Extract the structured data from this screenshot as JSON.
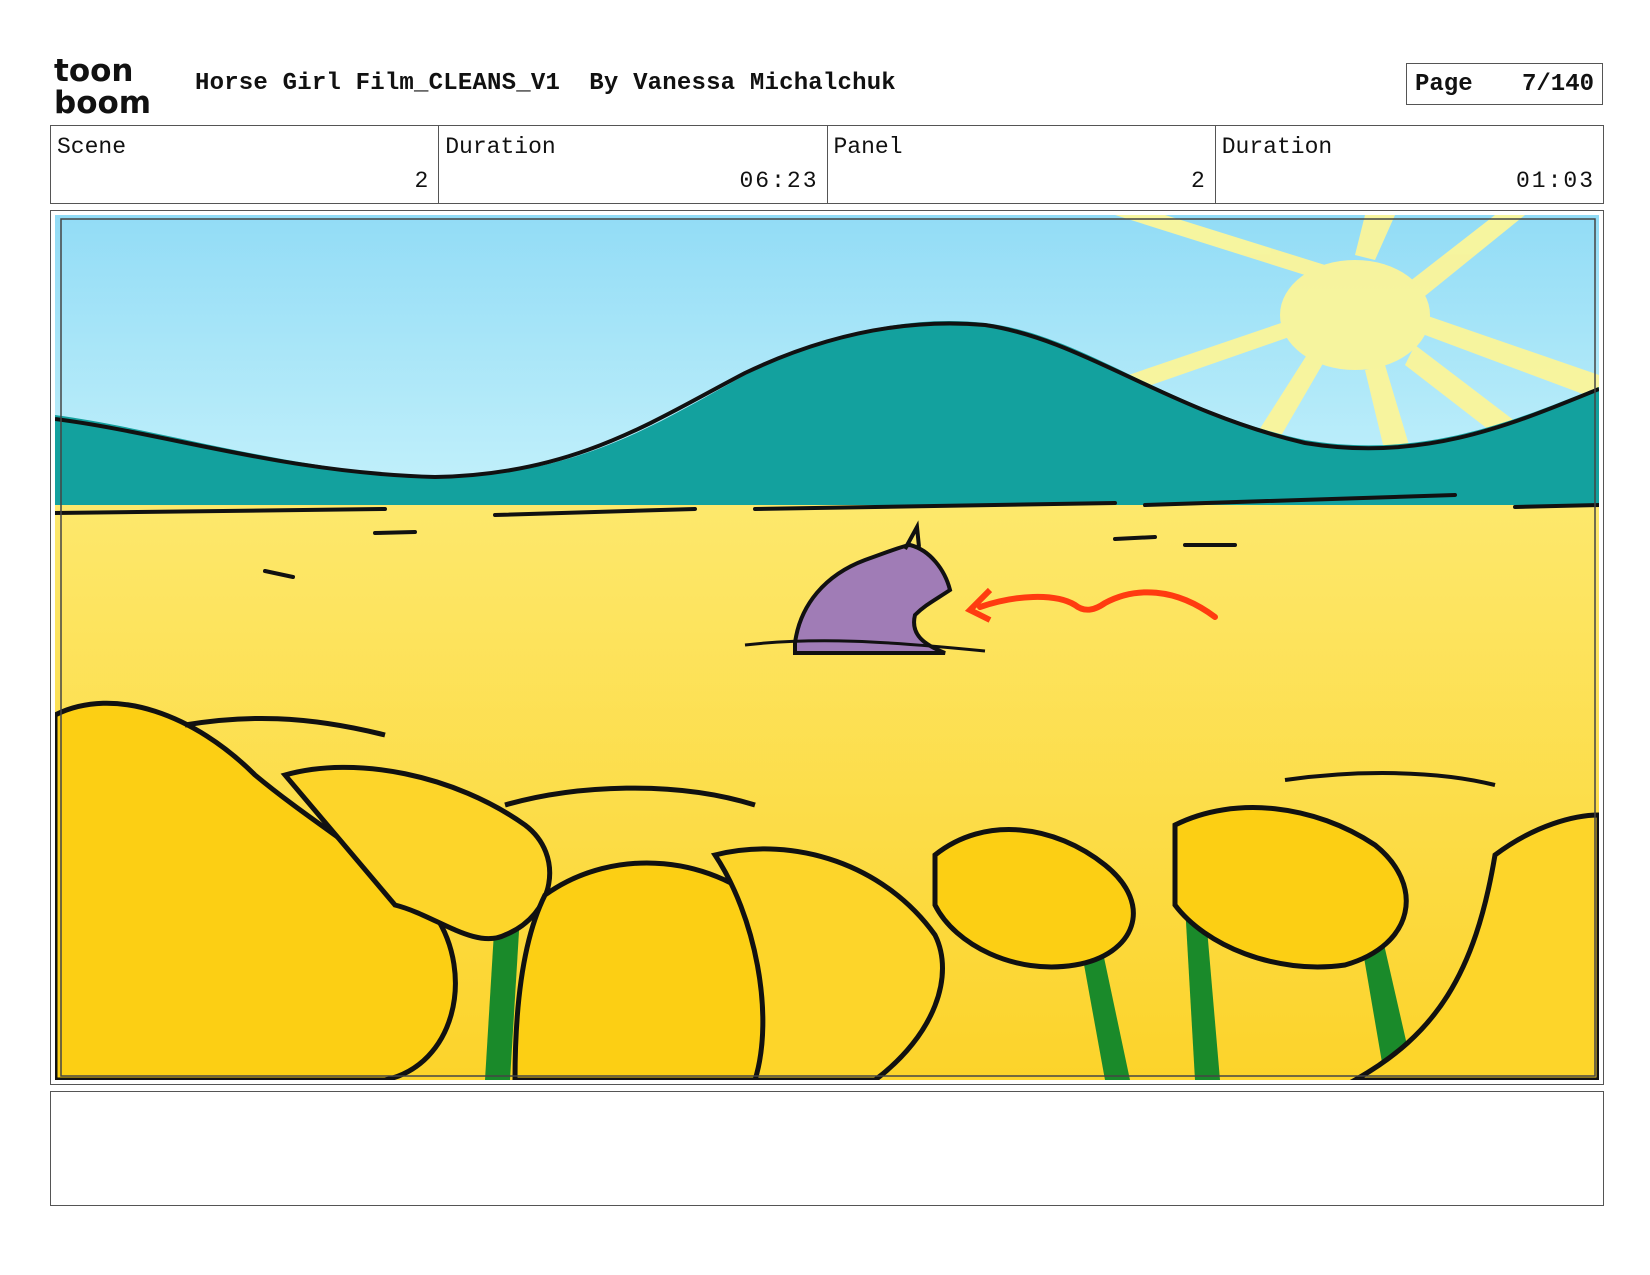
{
  "header": {
    "logo_text_top": "toon",
    "logo_text_bottom": "boom",
    "title": "Horse Girl Film_CLEANS_V1  By Vanessa Michalchuk",
    "page_label": "Page",
    "page_value": "7/140"
  },
  "info": {
    "scene_label": "Scene",
    "scene_value": "2",
    "scene_duration_label": "Duration",
    "scene_duration_value": "06:23",
    "panel_label": "Panel",
    "panel_value": "2",
    "panel_duration_label": "Duration",
    "panel_duration_value": "01:03"
  },
  "panel_image": {
    "icons": [
      "sun-icon",
      "hill-icon",
      "horse-icon",
      "arrow-icon",
      "flowers-icon"
    ],
    "colors": {
      "sky": "#a8e6f8",
      "hill": "#14a3a0",
      "field": "#fde15c",
      "horse": "#a07cb6",
      "arrow": "#ff3b10",
      "flowers": "#fccf14",
      "stems": "#1a8a2a",
      "sun": "#fbf59a"
    }
  },
  "notes": {
    "text": ""
  }
}
